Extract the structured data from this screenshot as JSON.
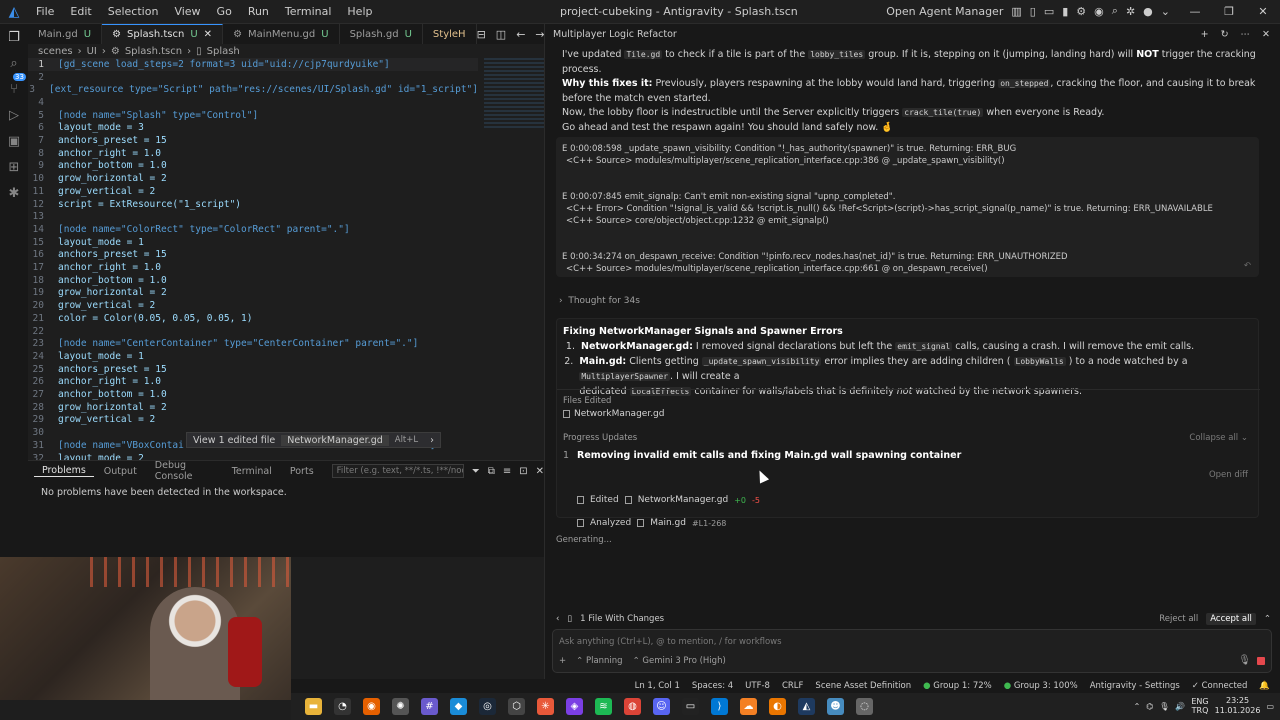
{
  "window": {
    "title": "project-cubeking - Antigravity - Splash.tscn",
    "menu": [
      "File",
      "Edit",
      "Selection",
      "View",
      "Go",
      "Run",
      "Terminal",
      "Help"
    ],
    "open_agent_manager": "Open Agent Manager"
  },
  "tabs": [
    {
      "label": "Main.gd",
      "status": "U"
    },
    {
      "label": "Splash.tscn",
      "status": "U"
    },
    {
      "label": "MainMenu.gd",
      "status": "U"
    },
    {
      "label": "Splash.gd",
      "status": "U"
    },
    {
      "label": "StyleH",
      "status": ""
    }
  ],
  "breadcrumb": [
    "scenes",
    "UI",
    "Splash.tscn",
    "Splash"
  ],
  "activity_badge": "33",
  "editor": {
    "lines": [
      {
        "n": "1",
        "text": "[gd_scene load_steps=2 format=3 uid=\"uid://cjp7qurdyuike\"]"
      },
      {
        "n": "2",
        "text": ""
      },
      {
        "n": "3",
        "text": "[ext_resource type=\"Script\" path=\"res://scenes/UI/Splash.gd\" id=\"1_script\"]"
      },
      {
        "n": "4",
        "text": ""
      },
      {
        "n": "5",
        "text": "[node name=\"Splash\" type=\"Control\"]"
      },
      {
        "n": "6",
        "text": "layout_mode = 3"
      },
      {
        "n": "7",
        "text": "anchors_preset = 15"
      },
      {
        "n": "8",
        "text": "anchor_right = 1.0"
      },
      {
        "n": "9",
        "text": "anchor_bottom = 1.0"
      },
      {
        "n": "10",
        "text": "grow_horizontal = 2"
      },
      {
        "n": "11",
        "text": "grow_vertical = 2"
      },
      {
        "n": "12",
        "text": "script = ExtResource(\"1_script\")"
      },
      {
        "n": "13",
        "text": ""
      },
      {
        "n": "14",
        "text": "[node name=\"ColorRect\" type=\"ColorRect\" parent=\".\"]"
      },
      {
        "n": "15",
        "text": "layout_mode = 1"
      },
      {
        "n": "16",
        "text": "anchors_preset = 15"
      },
      {
        "n": "17",
        "text": "anchor_right = 1.0"
      },
      {
        "n": "18",
        "text": "anchor_bottom = 1.0"
      },
      {
        "n": "19",
        "text": "grow_horizontal = 2"
      },
      {
        "n": "20",
        "text": "grow_vertical = 2"
      },
      {
        "n": "21",
        "text": "color = Color(0.05, 0.05, 0.05, 1)"
      },
      {
        "n": "22",
        "text": ""
      },
      {
        "n": "23",
        "text": "[node name=\"CenterContainer\" type=\"CenterContainer\" parent=\".\"]"
      },
      {
        "n": "24",
        "text": "layout_mode = 1"
      },
      {
        "n": "25",
        "text": "anchors_preset = 15"
      },
      {
        "n": "26",
        "text": "anchor_right = 1.0"
      },
      {
        "n": "27",
        "text": "anchor_bottom = 1.0"
      },
      {
        "n": "28",
        "text": "grow_horizontal = 2"
      },
      {
        "n": "29",
        "text": "grow_vertical = 2"
      },
      {
        "n": "30",
        "text": ""
      },
      {
        "n": "31",
        "text": "[node name=\"VBoxContai                                rContainer\"]"
      },
      {
        "n": "32",
        "text": "layout_mode = 2"
      }
    ],
    "hover_chip": {
      "label": "View 1 edited file",
      "file": "NetworkManager.gd",
      "shortcut": "Alt+L"
    }
  },
  "panel": {
    "tabs": [
      "Problems",
      "Output",
      "Debug Console",
      "Terminal",
      "Ports"
    ],
    "filter_placeholder": "Filter (e.g. text, **/*.ts, !**/node_modules/**)",
    "message": "No problems have been detected in the workspace."
  },
  "agent": {
    "title": "Multiplayer Logic Refactor",
    "intro": {
      "l1a": "I've updated",
      "l1code1": "Tile.gd",
      "l1b": "to check if a tile is part of the",
      "l1code2": "lobby_tiles",
      "l1c": "group. If it is, stepping on it (jumping, landing hard) will",
      "l1bold": "NOT",
      "l1d": "trigger the cracking process.",
      "l2bold": "Why this fixes it:",
      "l2a": "Previously, players respawning at the lobby would land hard, triggering",
      "l2code": "on_stepped",
      "l2b": ", cracking the floor, and causing it to break before the match even started.",
      "l3a": "Now, the lobby floor is indestructible until the Server explicitly triggers",
      "l3code": "crack_tile(true)",
      "l3b": "when everyone is Ready.",
      "l4": "Go ahead and test the respawn again! You should land safely now."
    },
    "errors": [
      {
        "main": "E 0:00:08:598   _update_spawn_visibility: Condition \"!_has_authority(spawner)\" is true. Returning: ERR_BUG",
        "sub": [
          "<C++ Source>  modules/multiplayer/scene_replication_interface.cpp:386 @ _update_spawn_visibility()"
        ]
      },
      {
        "main": "E 0:00:07:845   emit_signalp: Can't emit non-existing signal \"upnp_completed\".",
        "sub": [
          "<C++ Error>    Condition \"!signal_is_valid && !script.is_null() && !Ref<Script>(script)->has_script_signal(p_name)\" is true. Returning: ERR_UNAVAILABLE",
          "<C++ Source>  core/object/object.cpp:1232 @ emit_signalp()"
        ]
      },
      {
        "main": "E 0:00:34:274   on_despawn_receive: Condition \"!pinfo.recv_nodes.has(net_id)\" is true. Returning: ERR_UNAUTHORIZED",
        "sub": [
          "<C++ Source>  modules/multiplayer/scene_replication_interface.cpp:661 @ on_despawn_receive()"
        ]
      }
    ],
    "thought": "Thought for 34s",
    "fix": {
      "title": "Fixing NetworkManager Signals and Spawner Errors",
      "i1bold": "NetworkManager.gd:",
      "i1a": "I removed signal declarations but left the",
      "i1code": "emit_signal",
      "i1b": "calls, causing a crash. I will remove the emit calls.",
      "i2bold": "Main.gd:",
      "i2a": "Clients getting",
      "i2code1": "_update_spawn_visibility",
      "i2b": "error implies they are adding children (",
      "i2code2": "LobbyWalls",
      "i2c": ") to a node watched by a",
      "i2code3": "MultiplayerSpawner",
      "i2d": ". I will create a",
      "i2e": "dedicated",
      "i2code4": "LocalEffects",
      "i2f": "container for walls/labels that is definitely",
      "i2em": "not",
      "i2g": "watched by the network spawners.",
      "files_label": "Files Edited",
      "file": "NetworkManager.gd",
      "progress_label": "Progress Updates",
      "collapse": "Collapse all",
      "progress_num": "1",
      "progress_title": "Removing invalid emit calls and fixing Main.gd wall spawning container",
      "step1_action": "Edited",
      "step1_file": "NetworkManager.gd",
      "step1_add": "+0",
      "step1_del": "-5",
      "step2_action": "Analyzed",
      "step2_file": "Main.gd",
      "step2_range": "#L1-268",
      "open_diff": "Open diff"
    },
    "generating": "Generating...",
    "changes": "1 File With Changes",
    "reject_all": "Reject all",
    "accept_all": "Accept all",
    "input_placeholder": "Ask anything (Ctrl+L), @ to mention, / for workflows",
    "mode": "Planning",
    "model": "Gemini 3 Pro (High)"
  },
  "statusbar": [
    "Ln 1, Col 1",
    "Spaces: 4",
    "UTF-8",
    "CRLF",
    "Scene Asset Definition",
    "Group 1: 72%",
    "Group 3: 100%",
    "Antigravity - Settings",
    "Connected"
  ],
  "taskbar": {
    "lang1": "ENG",
    "lang2": "TRQ",
    "time": "23:25",
    "date": "11.01.2026"
  }
}
